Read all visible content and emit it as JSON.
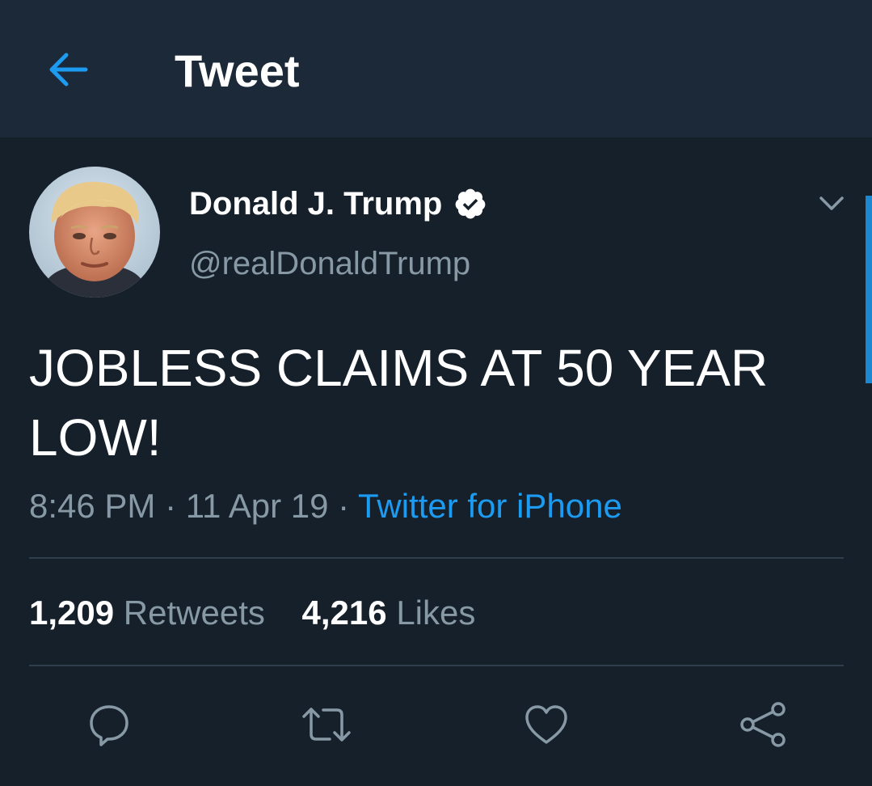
{
  "header": {
    "back_icon": "arrow-left-icon",
    "title": "Tweet"
  },
  "tweet": {
    "author": {
      "display_name": "Donald J. Trump",
      "handle": "@realDonaldTrump",
      "verified": true,
      "verified_icon": "verified-badge-icon"
    },
    "more_icon": "chevron-down-icon",
    "text": "JOBLESS CLAIMS AT 50 YEAR LOW!",
    "time": "8:46 PM",
    "separator": " · ",
    "date": "11 Apr 19",
    "source": "Twitter for iPhone",
    "stats": {
      "retweets_count": "1,209",
      "retweets_label": "Retweets",
      "likes_count": "4,216",
      "likes_label": "Likes"
    },
    "actions": [
      {
        "icon": "reply-icon"
      },
      {
        "icon": "retweet-icon"
      },
      {
        "icon": "like-icon"
      },
      {
        "icon": "share-icon"
      }
    ]
  },
  "colors": {
    "background": "#15202b",
    "header_background": "#1c2938",
    "accent": "#1d9bf0",
    "secondary_text": "#8899a6",
    "divider": "#2f3d4d"
  }
}
